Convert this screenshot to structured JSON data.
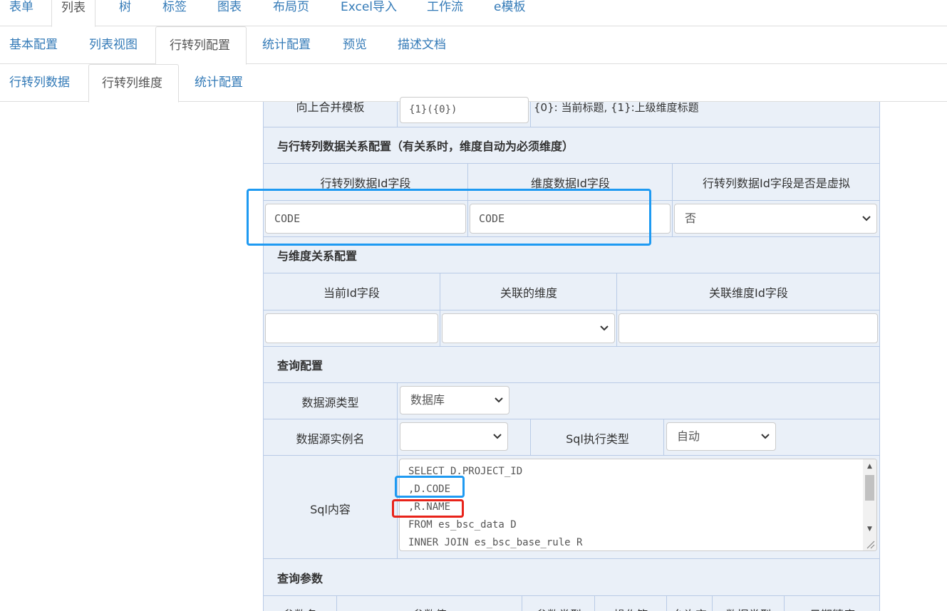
{
  "tabs_top": [
    "表单",
    "列表",
    "树",
    "标签",
    "图表",
    "布局页",
    "Excel导入",
    "工作流",
    "e模板"
  ],
  "tabs_second": [
    "基本配置",
    "列表视图",
    "行转列配置",
    "统计配置",
    "预览",
    "描述文档"
  ],
  "tabs_third": [
    "行转列数据",
    "行转列维度",
    "统计配置"
  ],
  "merge": {
    "label": "向上合并模板",
    "value": "{1}({0})",
    "hint": "{0}: 当前标题, {1}:上级维度标题"
  },
  "relation_section": {
    "title": "与行转列数据关系配置（有关系时，维度自动为必须维度）",
    "headers": [
      "行转列数据Id字段",
      "维度数据Id字段",
      "行转列数据Id字段是否是虚拟"
    ],
    "data_id_value": "CODE",
    "dim_id_value": "CODE",
    "virtual_value": "否"
  },
  "dim_relation_section": {
    "title": "与维度关系配置",
    "headers": [
      "当前Id字段",
      "关联的维度",
      "关联维度Id字段"
    ]
  },
  "query_section": {
    "title": "查询配置",
    "datasource_type_label": "数据源类型",
    "datasource_type_value": "数据库",
    "datasource_instance_label": "数据源实例名",
    "sql_exec_type_label": "Sql执行类型",
    "sql_exec_type_value": "自动",
    "sql_label": "Sql内容",
    "sql_lines": [
      "SELECT D.PROJECT_ID",
      ",D.CODE",
      ",R.NAME",
      "FROM es_bsc_data D",
      "INNER JOIN es_bsc_base_rule R"
    ]
  },
  "params_section": {
    "title": "查询参数",
    "headers": [
      "参数名",
      "参数值",
      "参数类型",
      "操作符",
      "允许空",
      "数据类型",
      "日期精度"
    ]
  },
  "colors": {
    "link": "#337ab7",
    "table_bg": "#eaf0f8",
    "table_border": "#b9cbe6",
    "highlight_blue": "#1e9af2",
    "highlight_red": "#e8231a"
  }
}
